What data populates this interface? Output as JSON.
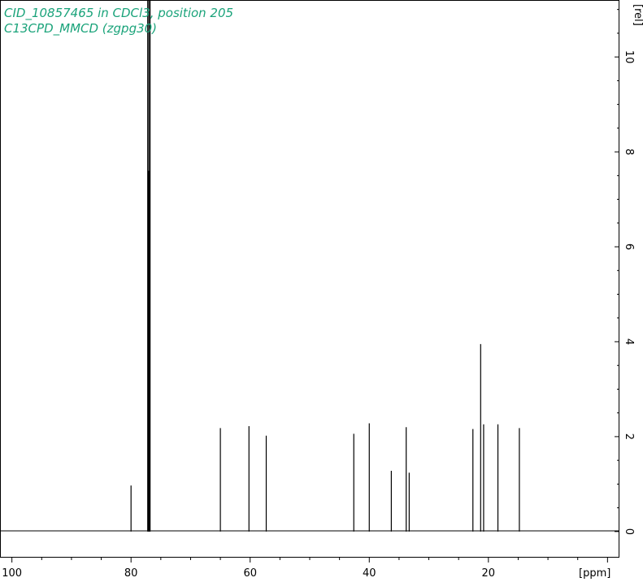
{
  "header": {
    "line1": "CID_10857465 in CDCl3, position 205",
    "line2": "C13CPD_MMCD (zgpg30)",
    "color": "#1aa37a"
  },
  "chart_data": {
    "type": "line",
    "xlabel": "[ppm]",
    "ylabel": "[rel]",
    "x_axis_reversed": true,
    "xlim": [
      102,
      -2
    ],
    "ylim": [
      -0.55,
      11.2
    ],
    "x_ticks": [
      100,
      80,
      60,
      40,
      20
    ],
    "y_ticks": [
      0,
      2,
      4,
      6,
      8,
      10
    ],
    "grid": false,
    "series": [
      {
        "line_color": "#000000",
        "peaks": [
          {
            "x": 80.0,
            "y": 0.97
          },
          {
            "x": 77.2,
            "y": 11.2
          },
          {
            "x": 77.0,
            "y": 11.2
          },
          {
            "x": 76.8,
            "y": 11.2
          },
          {
            "x": 65.0,
            "y": 2.18
          },
          {
            "x": 60.2,
            "y": 2.22
          },
          {
            "x": 57.3,
            "y": 2.02
          },
          {
            "x": 42.6,
            "y": 2.06
          },
          {
            "x": 40.0,
            "y": 2.28
          },
          {
            "x": 36.3,
            "y": 1.28
          },
          {
            "x": 33.8,
            "y": 2.2
          },
          {
            "x": 33.3,
            "y": 1.24
          },
          {
            "x": 22.6,
            "y": 2.16
          },
          {
            "x": 21.3,
            "y": 3.95
          },
          {
            "x": 20.8,
            "y": 2.26
          },
          {
            "x": 18.4,
            "y": 2.26
          },
          {
            "x": 14.8,
            "y": 2.18
          }
        ]
      }
    ]
  }
}
